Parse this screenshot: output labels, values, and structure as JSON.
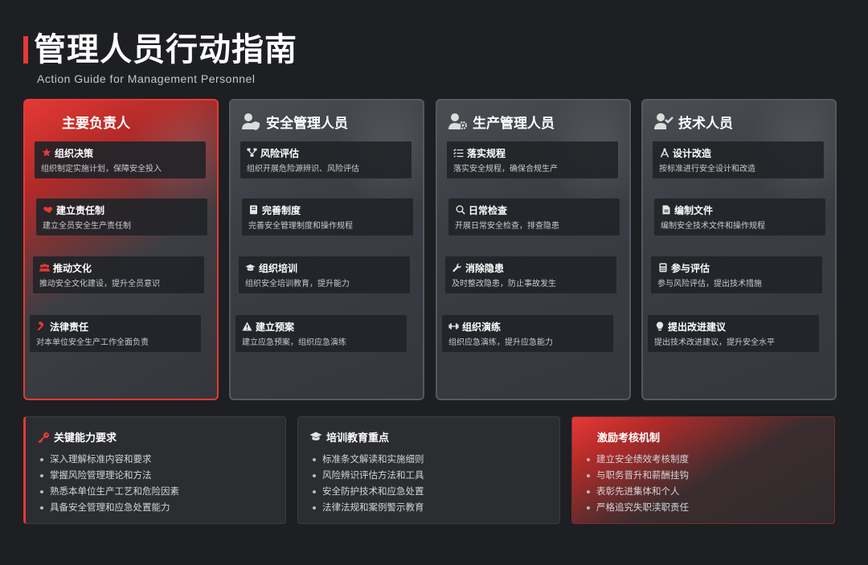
{
  "header": {
    "title": "管理人员行动指南",
    "subtitle": "Action Guide for Management Personnel"
  },
  "roles": [
    {
      "title": "主要负责人",
      "icon": "none",
      "items": [
        {
          "title": "组织决策",
          "desc": "组织制定实施计划，保障安全投入",
          "icon": "star-icon"
        },
        {
          "title": "建立责任制",
          "desc": "建立全员安全生产责任制",
          "icon": "handshake-icon"
        },
        {
          "title": "推动文化",
          "desc": "推动安全文化建设，提升全员意识",
          "icon": "people-icon"
        },
        {
          "title": "法律责任",
          "desc": "对本单位安全生产工作全面负责",
          "icon": "gavel-icon"
        }
      ]
    },
    {
      "title": "安全管理人员",
      "icon": "user-shield-icon",
      "items": [
        {
          "title": "风险评估",
          "desc": "组织开展危险源辨识、风险评估",
          "icon": "network-icon"
        },
        {
          "title": "完善制度",
          "desc": "完善安全管理制度和操作规程",
          "icon": "book-icon"
        },
        {
          "title": "组织培训",
          "desc": "组织安全培训教育，提升能力",
          "icon": "graduation-cap-icon"
        },
        {
          "title": "建立预案",
          "desc": "建立应急预案，组织应急演练",
          "icon": "warning-icon"
        }
      ]
    },
    {
      "title": "生产管理人员",
      "icon": "user-gear-icon",
      "items": [
        {
          "title": "落实规程",
          "desc": "落实安全规程，确保合规生产",
          "icon": "list-check-icon"
        },
        {
          "title": "日常检查",
          "desc": "开展日常安全检查，排查隐患",
          "icon": "search-icon"
        },
        {
          "title": "消除隐患",
          "desc": "及时整改隐患，防止事故发生",
          "icon": "wrench-icon"
        },
        {
          "title": "组织演练",
          "desc": "组织应急演练，提升应急能力",
          "icon": "dumbbell-icon"
        }
      ]
    },
    {
      "title": "技术人员",
      "icon": "user-check-icon",
      "items": [
        {
          "title": "设计改造",
          "desc": "按标准进行安全设计和改造",
          "icon": "compass-icon"
        },
        {
          "title": "编制文件",
          "desc": "编制安全技术文件和操作规程",
          "icon": "file-icon"
        },
        {
          "title": "参与评估",
          "desc": "参与风险评估，提出技术措施",
          "icon": "calculator-icon"
        },
        {
          "title": "提出改进建议",
          "desc": "提出技术改进建议，提升安全水平",
          "icon": "lightbulb-icon"
        }
      ]
    }
  ],
  "bottom": [
    {
      "title": "关键能力要求",
      "icon": "key-icon",
      "items": [
        "深入理解标准内容和要求",
        "掌握风险管理理论和方法",
        "熟悉本单位生产工艺和危险因素",
        "具备安全管理和应急处置能力"
      ]
    },
    {
      "title": "培训教育重点",
      "icon": "graduation-cap-icon",
      "items": [
        "标准条文解读和实施细则",
        "风险辨识评估方法和工具",
        "安全防护技术和应急处置",
        "法律法规和案例警示教育"
      ]
    },
    {
      "title": "激励考核机制",
      "icon": "none",
      "items": [
        "建立安全绩效考核制度",
        "与职务晋升和薪酬挂钩",
        "表彰先进集体和个人",
        "严格追究失职渎职责任"
      ]
    }
  ],
  "colors": {
    "accent": "#e53935",
    "background": "#1d1f23",
    "card": "#3b3e44"
  }
}
